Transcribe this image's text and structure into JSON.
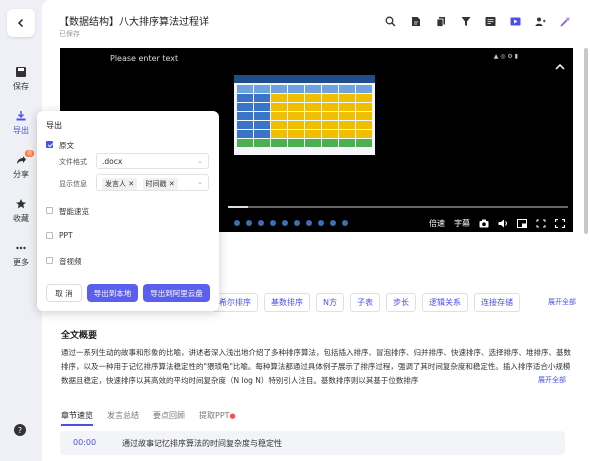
{
  "header": {
    "title": "【数据结构】八大排序算法过程详",
    "saved": "已保存"
  },
  "toolbar": {
    "icons": [
      "search-icon",
      "document-icon",
      "copy-icon",
      "filter-icon",
      "reader-icon",
      "video-icon",
      "people-icon",
      "magic-wand-icon"
    ]
  },
  "sidebar": {
    "save": "保存",
    "export": "导出",
    "share": "分享",
    "share_badge": "领",
    "collect": "收藏",
    "more": "更多"
  },
  "video": {
    "watermark": "Please enter text",
    "controls": {
      "speed": "倍速",
      "subtitle": "字幕"
    },
    "progress": 0.06
  },
  "keywords": {
    "items": [
      "希尔排序",
      "基数排序",
      "N方",
      "子表",
      "步长",
      "逻辑关系",
      "连接存储"
    ],
    "expand": "展开全部"
  },
  "summary": {
    "title": "全文概要",
    "text": "通过一系列生动的故事和形象的比喻，讲述者深入浅出地介绍了多种排序算法，包括插入排序、冒泡排序、归并排序、快速排序、选择排序、堆排序、基数排序，以及一种用于记忆排序算法稳定性的\"猥琐龟\"比喻。每种算法都通过具体例子展示了排序过程，强调了其时间复杂度和稳定性。插入排序适合小规模数据且稳定，快速排序以其高效的平均时间复杂度（N log N）特别引人注目。基数排序则以其基于位数排序",
    "expand": "展开全部"
  },
  "tabs": {
    "items": [
      "章节速览",
      "发言总结",
      "要点回顾",
      "提取PPT"
    ]
  },
  "chapter": {
    "time": "00:00",
    "text": "通过故事记忆排序算法的时间复杂度与稳定性"
  },
  "export_panel": {
    "title": "导出",
    "original": "原文",
    "format_label": "文件格式",
    "format_value": ".docx",
    "display_label": "显示信息",
    "chips": [
      "发言人",
      "时间戳"
    ],
    "smart": "智能速览",
    "ppt": "PPT",
    "audio_video": "音视频",
    "cancel": "取 消",
    "export_local": "导出到本地",
    "export_cloud": "导出到阿里云盘"
  },
  "colors": {
    "accent": "#4b50e6",
    "button": "#5b5ff0"
  }
}
